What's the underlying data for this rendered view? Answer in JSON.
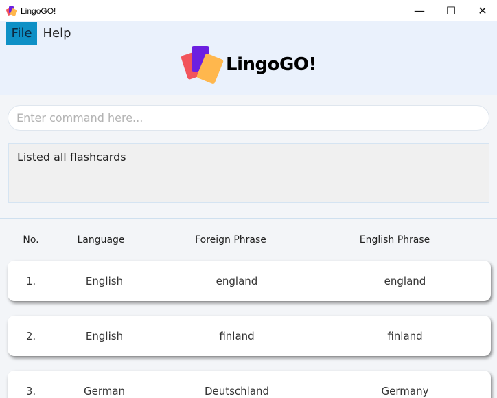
{
  "window": {
    "title": "LingoGO!",
    "controls": {
      "minimize": "—",
      "maximize": "☐",
      "close": "✕"
    }
  },
  "menu": {
    "file": "File",
    "help": "Help"
  },
  "logo": {
    "text": "LingoGO!",
    "colors": {
      "red": "#f2545b",
      "purple": "#6c1fe0",
      "orange": "#ffb74d"
    }
  },
  "command": {
    "placeholder": "Enter command here..."
  },
  "result": {
    "text": "Listed all flashcards"
  },
  "table": {
    "headers": [
      "No.",
      "Language",
      "Foreign Phrase",
      "English Phrase"
    ],
    "rows": [
      {
        "no": "1.",
        "language": "English",
        "foreign": "england",
        "english": "england"
      },
      {
        "no": "2.",
        "language": "English",
        "foreign": "finland",
        "english": "finland"
      },
      {
        "no": "3.",
        "language": "German",
        "foreign": "Deutschland",
        "english": "Germany"
      }
    ]
  },
  "colors": {
    "accent": "#0e90c6",
    "header_bg": "#eaf1fc",
    "panel_bg": "#f3f5f8"
  }
}
